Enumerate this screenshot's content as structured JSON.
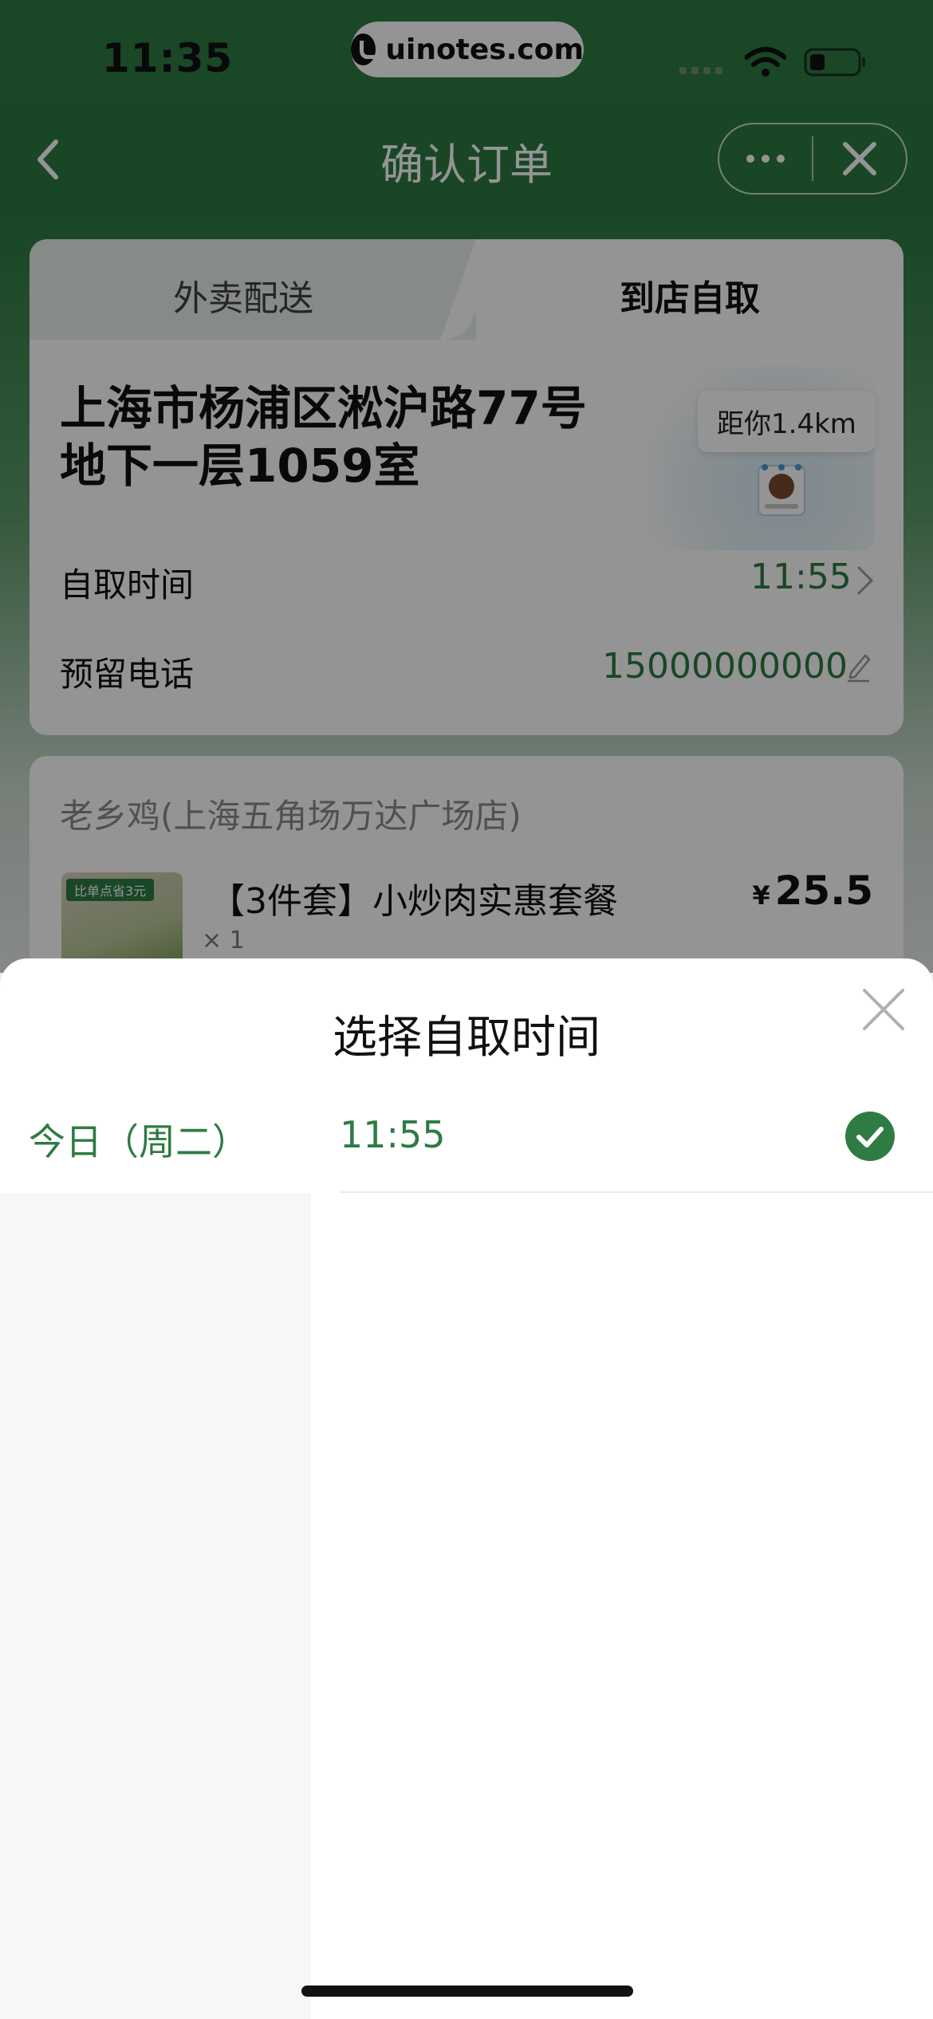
{
  "status_bar": {
    "time": "11:35",
    "url": "uinotes.com"
  },
  "nav": {
    "title": "确认订单"
  },
  "pickup_card": {
    "tabs": [
      {
        "label": "外卖配送",
        "selected": false
      },
      {
        "label": "到店自取",
        "selected": true
      }
    ],
    "address_line1": "上海市杨浦区淞沪路77号",
    "address_line2": "地下一层1059室",
    "distance": "距你1.4km",
    "pickup_time_label": "自取时间",
    "pickup_time_value": "11:55",
    "phone_label": "预留电话",
    "phone_value": "15000000000"
  },
  "order_card": {
    "store_name": "老乡鸡(上海五角场万达广场店)",
    "item": {
      "image_tag": "比单点省3元",
      "title": "【3件套】小炒肉实惠套餐",
      "quantity": "× 1",
      "currency": "¥",
      "price": "25.5"
    }
  },
  "time_sheet": {
    "title": "选择自取时间",
    "days": [
      {
        "label": "今日（周二）",
        "selected": true
      }
    ],
    "times": [
      {
        "label": "11:55",
        "selected": true
      }
    ]
  },
  "colors": {
    "brand_green": "#2e7b43",
    "header_green": "#2b7840",
    "overlay": "rgba(0,0,0,0.42)"
  }
}
